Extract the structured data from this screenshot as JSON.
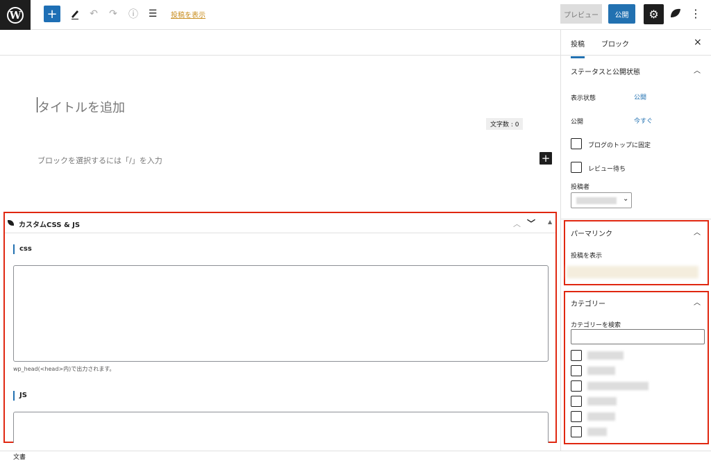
{
  "topbar": {
    "wp_logo": "W",
    "add_icon": "+",
    "undo_icon": "↶",
    "redo_icon": "↷",
    "info_icon": "ⓘ",
    "list_icon": "☰",
    "view_post_link": "投稿を表示",
    "preview_label": "プレビュー",
    "publish_label": "公開",
    "settings_icon": "⚙",
    "more_icon": "⋮"
  },
  "editor": {
    "title_placeholder": "タイトルを追加",
    "word_count": "文字数 : 0",
    "block_prompt": "ブロックを選択するには「/」を入力",
    "add_block": "+"
  },
  "meta_box": {
    "title": "カスタムCSS & JS",
    "css_label": "css",
    "css_help": "wp_head(<head>内)で出力されます。",
    "js_label": "JS"
  },
  "sidebar": {
    "tabs": [
      "投稿",
      "ブロック"
    ],
    "close": "×",
    "status_panel": {
      "title": "ステータスと公開状態",
      "visibility_label": "表示状態",
      "visibility_value": "公開",
      "publish_label": "公開",
      "publish_value": "今すぐ",
      "sticky_label": "ブログのトップに固定",
      "pending_label": "レビュー待ち",
      "author_label": "投稿者"
    },
    "permalink_panel": {
      "title": "パーマリンク",
      "view_label": "投稿を表示"
    },
    "category_panel": {
      "title": "カテゴリー",
      "search_label": "カテゴリーを検索"
    }
  },
  "footer": {
    "breadcrumb": "文書"
  },
  "colors": {
    "accent": "#2271b1",
    "highlight": "#e02710",
    "dark": "#1e1e1e"
  }
}
